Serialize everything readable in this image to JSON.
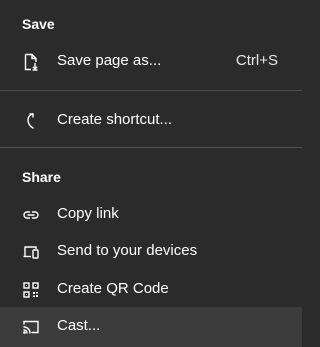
{
  "menu": {
    "save_section": {
      "header": "Save",
      "items": [
        {
          "label": "Save page as...",
          "shortcut": "Ctrl+S",
          "icon": "save-page-icon"
        }
      ]
    },
    "shortcut_section": {
      "items": [
        {
          "label": "Create shortcut...",
          "icon": "shortcut-icon"
        }
      ]
    },
    "share_section": {
      "header": "Share",
      "items": [
        {
          "label": "Copy link",
          "icon": "link-icon"
        },
        {
          "label": "Send to your devices",
          "icon": "devices-icon"
        },
        {
          "label": "Create QR Code",
          "icon": "qr-code-icon"
        },
        {
          "label": "Cast...",
          "icon": "cast-icon",
          "hovered": true
        }
      ]
    },
    "colors": {
      "background": "#2b2b2b",
      "hover": "#3b3b3b",
      "divider": "#505050",
      "text": "#ffffff"
    }
  }
}
